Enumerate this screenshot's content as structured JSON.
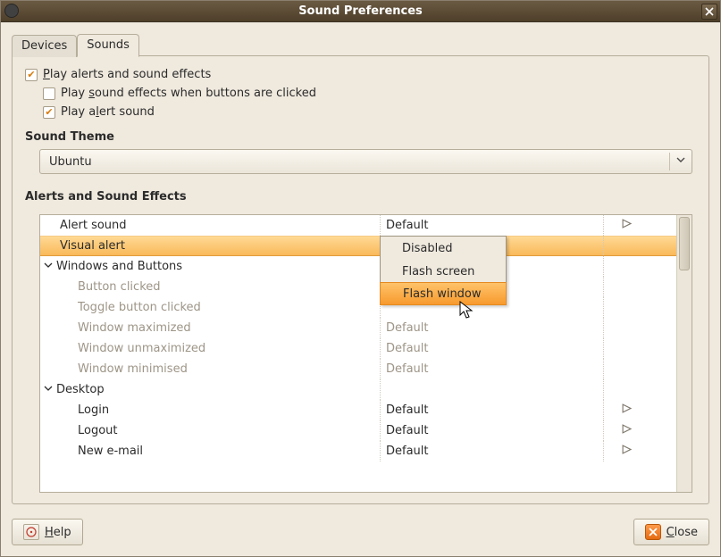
{
  "window": {
    "title": "Sound Preferences"
  },
  "tabs": {
    "devices": "Devices",
    "sounds": "Sounds"
  },
  "opts": {
    "play_alerts_full": "Play alerts and sound effects",
    "play_alerts_pre": "",
    "play_alerts_mn": "P",
    "play_alerts_post": "lay alerts and sound effects",
    "play_click_pre": "Play ",
    "play_click_mn": "s",
    "play_click_post": "ound effects when buttons are clicked",
    "play_alert_sound_pre": "Play a",
    "play_alert_sound_mn": "l",
    "play_alert_sound_post": "ert sound"
  },
  "section_theme": "Sound Theme",
  "combo": {
    "value": "Ubuntu"
  },
  "section_list": "Alerts and Sound Effects",
  "col_default": "Default",
  "rows": {
    "alert_sound": "Alert sound",
    "visual_alert": "Visual alert",
    "win_buttons": "Windows and Buttons",
    "button_clicked": "Button clicked",
    "toggle_clicked": "Toggle button clicked",
    "win_max": "Window maximized",
    "win_unmax": "Window unmaximized",
    "win_min": "Window minimised",
    "desktop": "Desktop",
    "login": "Login",
    "logout": "Logout",
    "newmail": "New e-mail"
  },
  "dropdown": {
    "disabled": "Disabled",
    "flash_screen": "Flash screen",
    "flash_window": "Flash window"
  },
  "buttons": {
    "help_mn": "H",
    "help_post": "elp",
    "close_mn": "C",
    "close_post": "lose"
  }
}
